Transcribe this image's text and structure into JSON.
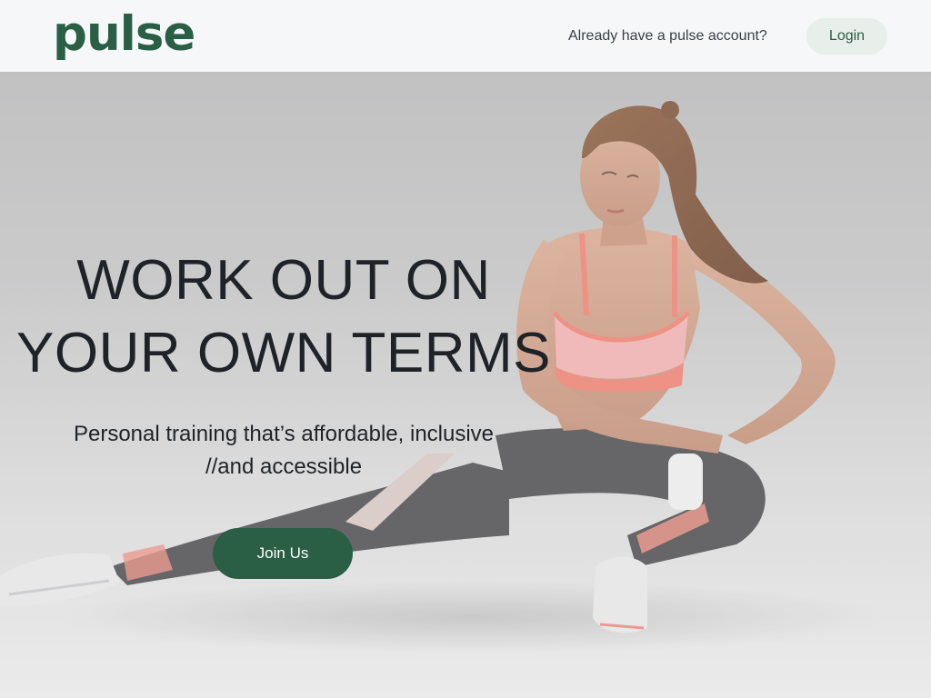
{
  "header": {
    "logo_text": "pulse",
    "account_prompt": "Already have a pulse account?",
    "login_label": "Login"
  },
  "hero": {
    "headline_line1": "WORK OUT ON",
    "headline_line2": "YOUR OWN TERMS",
    "subline_line1": "Personal training that’s affordable, inclusive",
    "subline_line2": "//and accessible",
    "join_label": "Join Us",
    "image_subject": "woman-stretching-photo"
  },
  "colors": {
    "brand_green": "#2a5e45",
    "header_bg": "#f5f7f9",
    "login_bg": "#e8eeea",
    "text_dark": "#1f2328"
  }
}
